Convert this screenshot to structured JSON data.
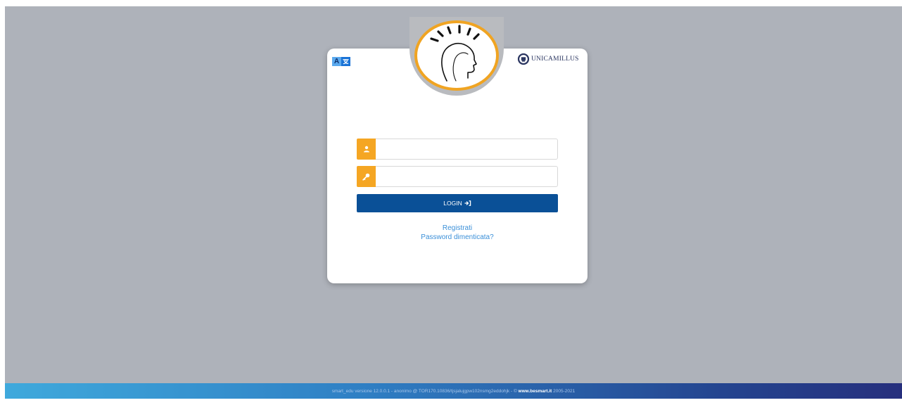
{
  "accessibility": {
    "icon_a": "A",
    "icon_b": "æ"
  },
  "brand": {
    "institution_name": "UNICAMILLUS"
  },
  "form": {
    "username_value": "",
    "password_value": "",
    "login_label": "LOGIN",
    "register_label": "Registrati",
    "forgot_label": "Password dimenticata?"
  },
  "footer": {
    "version_text": "smart_edu versione 12.0.0.1 - anonimo @ TOR170.10836/tjsjalujgpw102nsmg2eddohjk - © ",
    "site_link": "www.besmart.it",
    "years": " 2005-2021"
  },
  "colors": {
    "background": "#aeb2ba",
    "accent_orange": "#f5a623",
    "login_blue": "#0a5097",
    "link_blue": "#3a8fd8"
  }
}
